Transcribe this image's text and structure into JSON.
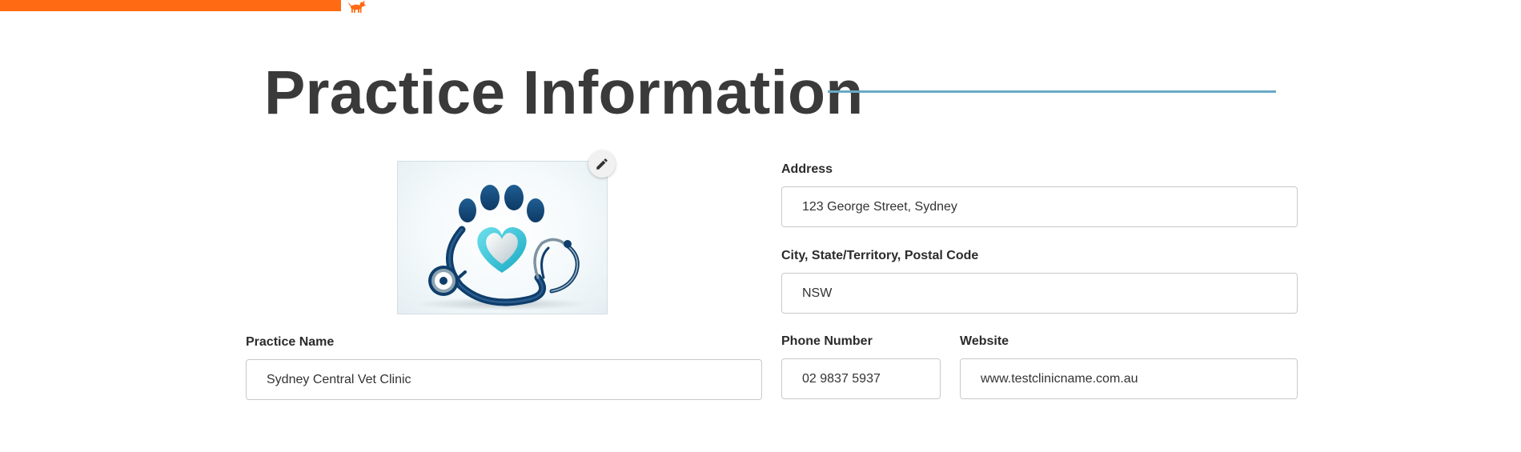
{
  "progress": {
    "fraction": 0.224,
    "color": "#ff6a13",
    "marker_icon": "dog-icon"
  },
  "header": {
    "title": "Practice Information",
    "rule_color": "#6aa9c4"
  },
  "logo": {
    "icon": "paw-heart-stethoscope-logo",
    "edit_icon": "pencil-icon"
  },
  "form": {
    "address": {
      "label": "Address",
      "value": "123 George Street, Sydney"
    },
    "city_state_postal": {
      "label": "City, State/Territory, Postal Code",
      "value": "NSW"
    },
    "practice_name": {
      "label": "Practice Name",
      "value": "Sydney Central Vet Clinic"
    },
    "phone": {
      "label": "Phone Number",
      "value": "02 9837 5937"
    },
    "website": {
      "label": "Website",
      "value": "www.testclinicname.com.au"
    }
  }
}
